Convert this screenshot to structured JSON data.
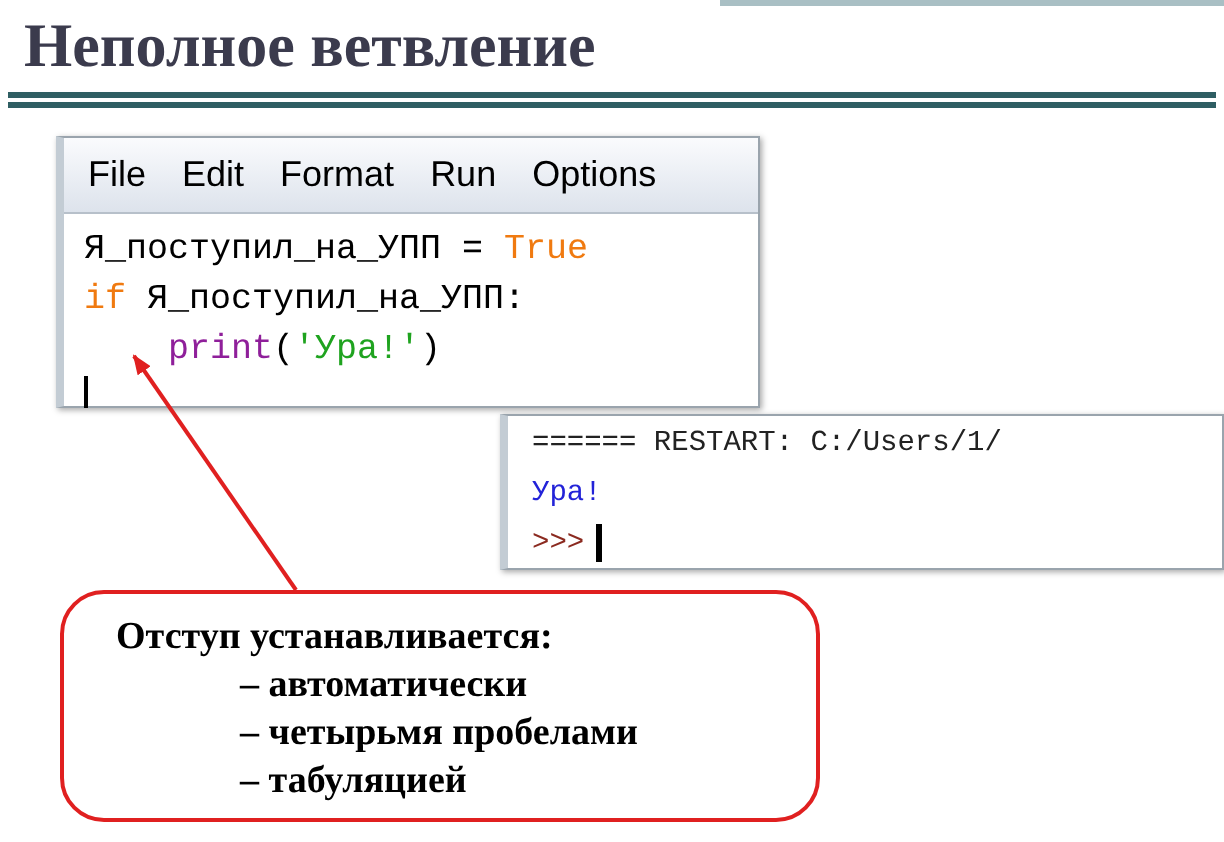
{
  "title": "Неполное ветвление",
  "editor": {
    "menu": [
      {
        "label": "File"
      },
      {
        "label": "Edit"
      },
      {
        "label": "Format"
      },
      {
        "label": "Run"
      },
      {
        "label": "Options"
      }
    ],
    "lines": [
      {
        "tokens": [
          {
            "text": "Я_поступил_на_УПП = ",
            "kind": "plain"
          },
          {
            "text": "True",
            "kind": "keyword"
          }
        ]
      },
      {
        "tokens": [
          {
            "text": "if",
            "kind": "keyword"
          },
          {
            "text": " Я_поступил_на_УПП:",
            "kind": "plain"
          }
        ]
      },
      {
        "indented": true,
        "tokens": [
          {
            "text": "print",
            "kind": "builtin"
          },
          {
            "text": "(",
            "kind": "plain"
          },
          {
            "text": "'Ура!'",
            "kind": "string"
          },
          {
            "text": ")",
            "kind": "plain"
          }
        ]
      }
    ]
  },
  "shell": {
    "lines": [
      {
        "text": "====== RESTART: C:/Users/1/",
        "kind": "restart"
      },
      {
        "text": "Ура!",
        "kind": "output"
      },
      {
        "text": ">>>",
        "kind": "prompt"
      }
    ]
  },
  "callout": {
    "heading": "Отступ устанавливается:",
    "items": [
      "– автоматически",
      "– четырьмя пробелами",
      "– табуляцией"
    ]
  }
}
